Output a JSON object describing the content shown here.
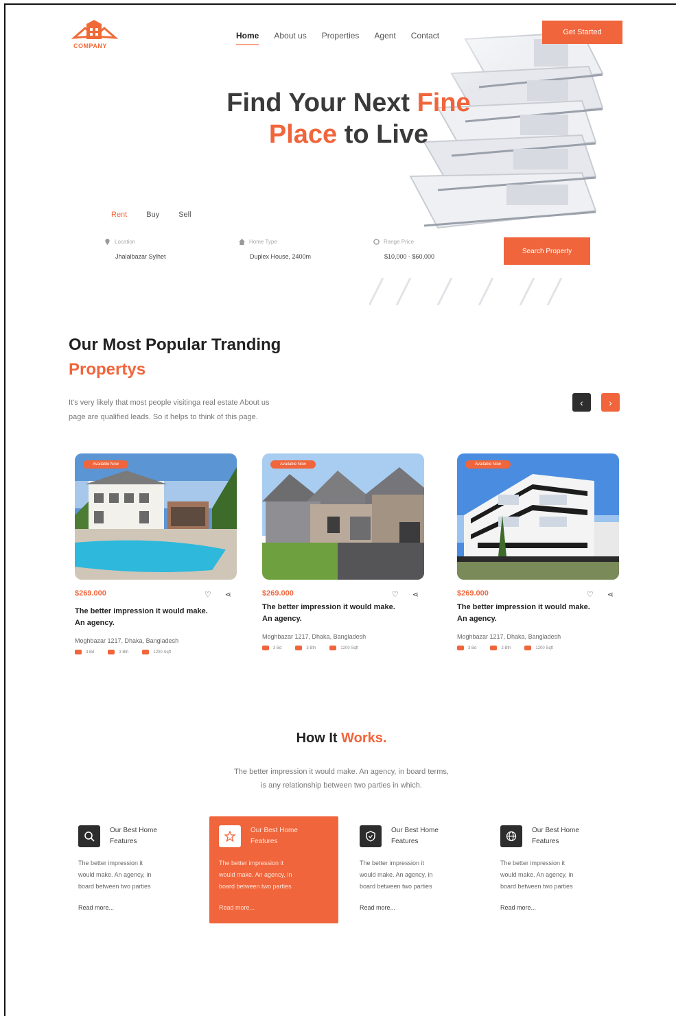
{
  "brand": {
    "name": "COMPANY",
    "accent": "#f0653b",
    "dark": "#2d2d2d"
  },
  "nav": {
    "items": [
      {
        "label": "Home",
        "active": true
      },
      {
        "label": "About us"
      },
      {
        "label": "Properties"
      },
      {
        "label": "Agent"
      },
      {
        "label": "Contact"
      }
    ],
    "cta": "Get Started"
  },
  "hero": {
    "title_a": "Find Your Next ",
    "title_hl1": "Fine",
    "title_hl2": "Place",
    "title_b": " to Live"
  },
  "search": {
    "tabs": [
      "Rent",
      "Buy",
      "Sell"
    ],
    "active_tab": "Rent",
    "fields": [
      {
        "icon": "location-icon",
        "label": "Location",
        "value": "Jhalalbazar Sylhet"
      },
      {
        "icon": "home-icon",
        "label": "Home Type",
        "value": "Duplex House, 2400m"
      },
      {
        "icon": "price-icon",
        "label": "Range Price",
        "value": "$10,000 - $60,000"
      }
    ],
    "button": "Search Property"
  },
  "popular": {
    "title": "Our Most  Popular Tranding",
    "title_hl": "Propertys",
    "desc_1": "It's very likely that most people visitinga real estate About us",
    "desc_2": "page are qualified leads. So it helps to think of this page.",
    "prev": "‹",
    "next": "›",
    "cards": [
      {
        "badge": "Available Now",
        "price": "$269.000",
        "title_1": "The better impression it would make.",
        "title_2": "An agency.",
        "address": "Moghbazar 1217, Dhaka, Bangladesh",
        "beds": "3 Bd",
        "baths": "3 Bth",
        "area": "1200 Sqft"
      },
      {
        "badge": "Available Now",
        "price": "$269.000",
        "title_1": "The better impression it would make.",
        "title_2": "An agency.",
        "address": "Moghbazar 1217, Dhaka, Bangladesh",
        "beds": "3 Bd",
        "baths": "3 Bth",
        "area": "1200 Sqft"
      },
      {
        "badge": "Available Now",
        "price": "$269.000",
        "title_1": "The better impression it would make.",
        "title_2": "An agency.",
        "address": "Moghbazar 1217, Dhaka, Bangladesh",
        "beds": "3 Bd",
        "baths": "2 Bth",
        "area": "1200 Sqft"
      }
    ]
  },
  "how": {
    "title": "How It ",
    "title_hl": "Works.",
    "desc_1": "The better impression it would make. An agency, in board terms,",
    "desc_2": "is any relationship between two parties in which.",
    "features": [
      {
        "icon": "search-icon",
        "title_1": "Our Best Home",
        "title_2": "Features",
        "desc_1": "The better impression it",
        "desc_2": "would make. An agency, in",
        "desc_3": "board between two parties",
        "more": "Read more..."
      },
      {
        "icon": "star-icon",
        "title_1": "Our Best Home",
        "title_2": "Features",
        "desc_1": "The better impression it",
        "desc_2": "would make. An agency, in",
        "desc_3": "board between two parties",
        "more": "Read more...",
        "active": true
      },
      {
        "icon": "shield-icon",
        "title_1": "Our Best Home",
        "title_2": "Features",
        "desc_1": "The better impression it",
        "desc_2": "would make. An agency, in",
        "desc_3": "board between two parties",
        "more": "Read more..."
      },
      {
        "icon": "globe-icon",
        "title_1": "Our Best Home",
        "title_2": "Features",
        "desc_1": "The better impression it",
        "desc_2": "would make. An agency, in",
        "desc_3": "board between two parties",
        "more": "Read more..."
      }
    ]
  }
}
